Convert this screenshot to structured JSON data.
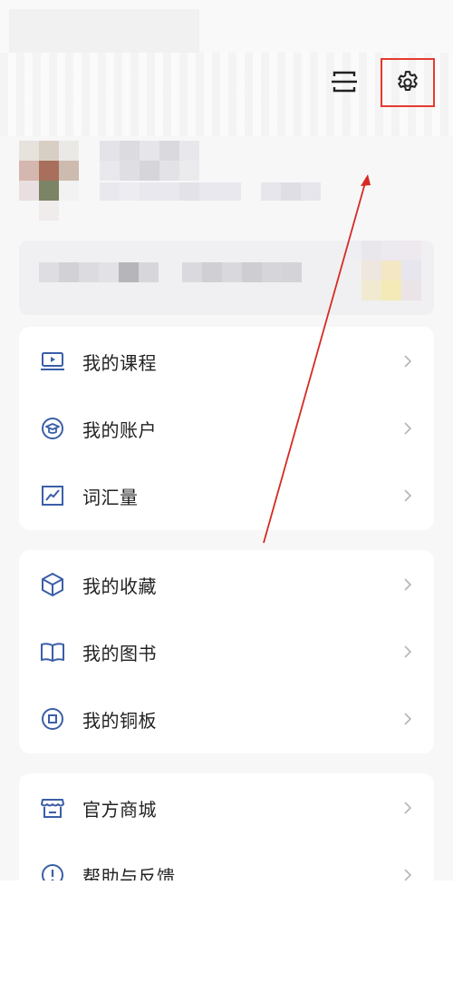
{
  "colors": {
    "accent": "#3b5ea8",
    "highlight": "#e63a2e",
    "arrow": "#d62a22",
    "chevron": "#b5b5b5"
  },
  "header": {
    "scan_icon": "scan-icon",
    "settings_icon": "gear-icon"
  },
  "menu_groups": [
    {
      "items": [
        {
          "label": "我的课程",
          "icon": "laptop-play-icon"
        },
        {
          "label": "我的账户",
          "icon": "graduation-cap-circle-icon"
        },
        {
          "label": "词汇量",
          "icon": "chart-line-icon"
        }
      ]
    },
    {
      "items": [
        {
          "label": "我的收藏",
          "icon": "cube-icon"
        },
        {
          "label": "我的图书",
          "icon": "open-book-icon"
        },
        {
          "label": "我的铜板",
          "icon": "coin-icon"
        }
      ]
    },
    {
      "items": [
        {
          "label": "官方商城",
          "icon": "store-icon"
        },
        {
          "label": "帮助与反馈",
          "icon": "exclamation-circle-icon"
        }
      ]
    }
  ]
}
